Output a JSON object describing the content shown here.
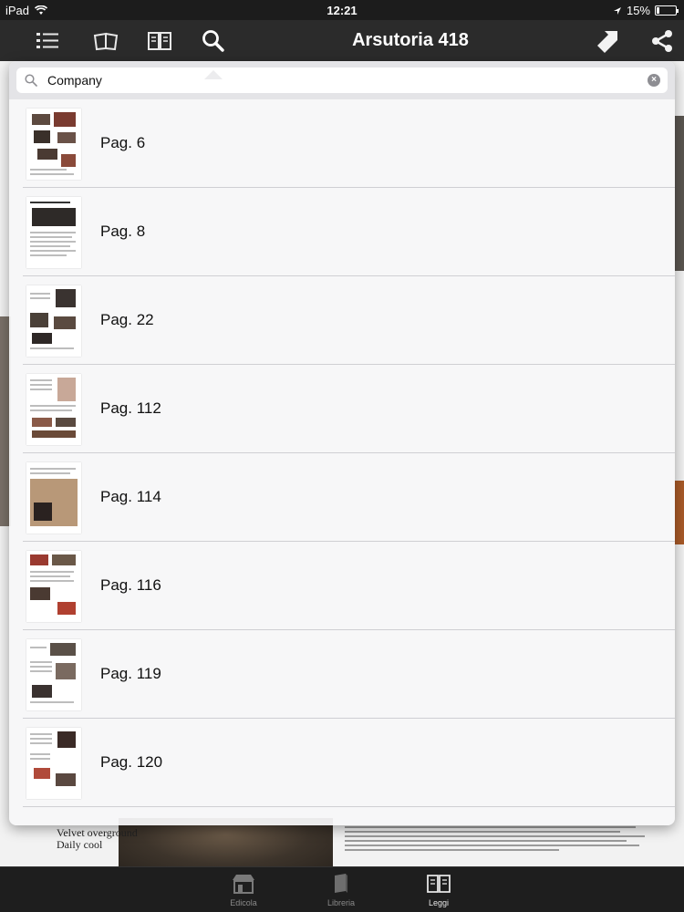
{
  "status_bar": {
    "device": "iPad",
    "time": "12:21",
    "battery": "15%",
    "battery_level": 0.15
  },
  "toolbar": {
    "title": "Arsutoria 418",
    "icons": [
      "list-icon",
      "pages-icon",
      "book-icon",
      "search-icon",
      "bookmark-icon",
      "share-icon"
    ]
  },
  "search": {
    "value": "Company",
    "placeholder": ""
  },
  "results": [
    {
      "label": "Pag. 6"
    },
    {
      "label": "Pag. 8"
    },
    {
      "label": "Pag. 22"
    },
    {
      "label": "Pag. 112"
    },
    {
      "label": "Pag. 114"
    },
    {
      "label": "Pag. 116"
    },
    {
      "label": "Pag. 119"
    },
    {
      "label": "Pag. 120"
    }
  ],
  "background_page": {
    "caption_line1": "Velvet overground",
    "caption_line2": "Daily cool"
  },
  "tabbar": {
    "tabs": [
      {
        "label": "Edicola"
      },
      {
        "label": "Libreria"
      },
      {
        "label": "Leggi"
      }
    ],
    "active": "Leggi"
  }
}
